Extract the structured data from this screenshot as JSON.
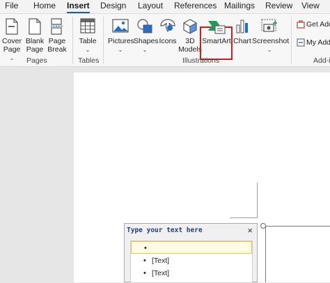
{
  "menu": {
    "tabs": [
      "File",
      "Home",
      "Insert",
      "Design",
      "Layout",
      "References",
      "Mailings",
      "Review",
      "View"
    ],
    "active": "Insert"
  },
  "ribbon": {
    "pages": {
      "cover_page": "Cover Page",
      "cover_page_line1": "Cover",
      "cover_page_line2": "Page",
      "blank_page_line1": "Blank",
      "blank_page_line2": "Page",
      "page_break_line1": "Page",
      "page_break_line2": "Break",
      "group_label": "Pages"
    },
    "tables": {
      "table": "Table",
      "group_label": "Tables"
    },
    "illustrations": {
      "pictures": "Pictures",
      "shapes": "Shapes",
      "icons": "Icons",
      "models_line1": "3D",
      "models_line2": "Models",
      "smartart": "SmartArt",
      "chart": "Chart",
      "screenshot": "Screenshot",
      "group_label": "Illustrations"
    },
    "addins": {
      "get_addins": "Get Add",
      "my_addins": "My Add",
      "group_label": "Add-in"
    }
  },
  "text_pane": {
    "title": "Type your text here",
    "close": "×",
    "rows": [
      {
        "bullet": "•",
        "text": ""
      },
      {
        "bullet": "•",
        "text": "[Text]"
      },
      {
        "bullet": "•",
        "text": "[Text]"
      }
    ]
  },
  "colors": {
    "accent": "#185abd",
    "highlight": "#d21b1b"
  }
}
